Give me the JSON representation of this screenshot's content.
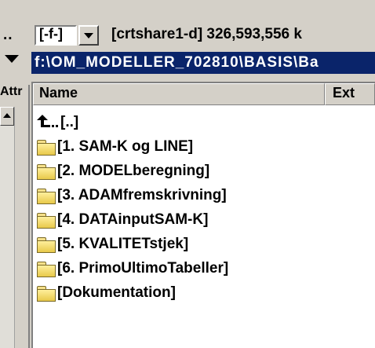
{
  "left_panel": {
    "dots_label": "..",
    "attr_header": "Attr"
  },
  "drive_bar": {
    "drive_value": "[-f-]",
    "share_info": "[crtshare1-d]  326,593,556 k"
  },
  "path_bar": {
    "path": "f:\\OM_MODELLER_702810\\BASIS\\Ba"
  },
  "columns": {
    "name": "Name",
    "ext": "Ext"
  },
  "files": [
    {
      "label": "[..]",
      "icon": "up-directory-icon"
    },
    {
      "label": "[1. SAM-K og LINE]",
      "icon": "folder-icon"
    },
    {
      "label": "[2. MODELberegning]",
      "icon": "folder-icon"
    },
    {
      "label": "[3. ADAMfremskrivning]",
      "icon": "folder-icon"
    },
    {
      "label": "[4. DATAinputSAM-K]",
      "icon": "folder-icon"
    },
    {
      "label": "[5. KVALITETstjek]",
      "icon": "folder-icon"
    },
    {
      "label": "[6. PrimoUltimoTabeller]",
      "icon": "folder-icon"
    },
    {
      "label": "[Dokumentation]",
      "icon": "folder-icon"
    }
  ],
  "colors": {
    "window_bg": "#d4d0c8",
    "path_bar_bg": "#0a246a",
    "path_text": "#ffffff",
    "file_panel_bg": "#ffffff",
    "folder_fill": "#ffef9c"
  }
}
